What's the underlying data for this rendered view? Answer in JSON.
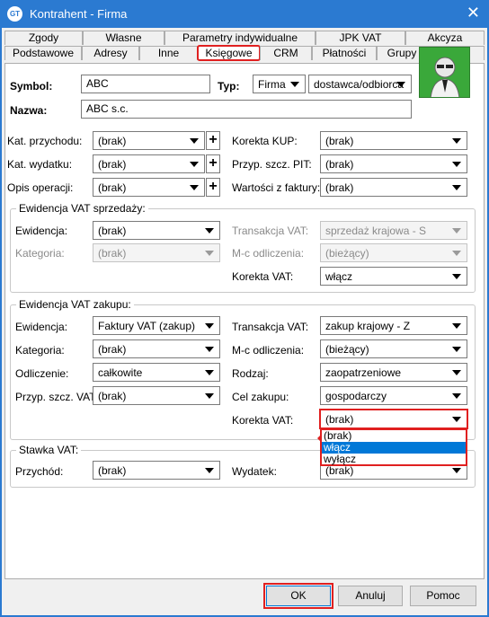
{
  "window": {
    "title": "Kontrahent - Firma",
    "app_icon_text": "GT"
  },
  "tabs": {
    "row1": [
      {
        "label": "Zgody"
      },
      {
        "label": "Własne"
      },
      {
        "label": "Parametry indywidualne"
      },
      {
        "label": "JPK VAT"
      },
      {
        "label": "Akcyza"
      }
    ],
    "row2": [
      {
        "label": "Podstawowe"
      },
      {
        "label": "Adresy"
      },
      {
        "label": "Inne"
      },
      {
        "label": "Księgowe"
      },
      {
        "label": "CRM"
      },
      {
        "label": "Płatności"
      },
      {
        "label": "Grupy"
      },
      {
        "label": "Opis"
      }
    ],
    "active": "Księgowe"
  },
  "header": {
    "symbol_label": "Symbol:",
    "symbol_value": "ABC",
    "typ_label": "Typ:",
    "typ_value": "Firma",
    "typ2_value": "dostawca/odbiorca",
    "nazwa_label": "Nazwa:",
    "nazwa_value": "ABC s.c."
  },
  "general": {
    "kat_przychodu_label": "Kat. przychodu:",
    "kat_przychodu_value": "(brak)",
    "kat_wydatku_label": "Kat. wydatku:",
    "kat_wydatku_value": "(brak)",
    "opis_operacji_label": "Opis operacji:",
    "opis_operacji_value": "(brak)",
    "korekta_kup_label": "Korekta KUP:",
    "korekta_kup_value": "(brak)",
    "przyp_pit_label": "Przyp. szcz. PIT:",
    "przyp_pit_value": "(brak)",
    "wartosci_label": "Wartości z faktury:",
    "wartosci_value": "(brak)",
    "plus_glyph": "+"
  },
  "sprzedaz": {
    "legend": "Ewidencja VAT sprzedaży:",
    "ewidencja_label": "Ewidencja:",
    "ewidencja_value": "(brak)",
    "kategoria_label": "Kategoria:",
    "kategoria_value": "(brak)",
    "transakcja_label": "Transakcja VAT:",
    "transakcja_value": "sprzedaż krajowa - S",
    "mc_label": "M-c odliczenia:",
    "mc_value": "(bieżący)",
    "korekta_label": "Korekta VAT:",
    "korekta_value": "włącz"
  },
  "zakup": {
    "legend": "Ewidencja VAT zakupu:",
    "ewidencja_label": "Ewidencja:",
    "ewidencja_value": "Faktury VAT (zakup)",
    "kategoria_label": "Kategoria:",
    "kategoria_value": "(brak)",
    "odliczenie_label": "Odliczenie:",
    "odliczenie_value": "całkowite",
    "przyp_vat_label": "Przyp. szcz. VAT:",
    "przyp_vat_value": "(brak)",
    "transakcja_label": "Transakcja VAT:",
    "transakcja_value": "zakup krajowy - Z",
    "mc_label": "M-c odliczenia:",
    "mc_value": "(bieżący)",
    "rodzaj_label": "Rodzaj:",
    "rodzaj_value": "zaopatrzeniowe",
    "cel_label": "Cel zakupu:",
    "cel_value": "gospodarczy",
    "korekta_label": "Korekta VAT:",
    "korekta_value": "(brak)",
    "korekta_options": [
      "(brak)",
      "włącz",
      "wyłącz"
    ],
    "korekta_highlighted": "włącz"
  },
  "stawka": {
    "legend": "Stawka VAT:",
    "przychod_label": "Przychód:",
    "przychod_value": "(brak)",
    "wydatek_label": "Wydatek:",
    "wydatek_value": "(brak)"
  },
  "footer": {
    "ok_label": "OK",
    "cancel_label": "Anuluj",
    "help_label": "Pomoc"
  },
  "colors": {
    "titlebar": "#2b7ad1",
    "highlight_red": "#e02020",
    "selection_blue": "#0078d7",
    "avatar_green": "#3aa83a"
  }
}
